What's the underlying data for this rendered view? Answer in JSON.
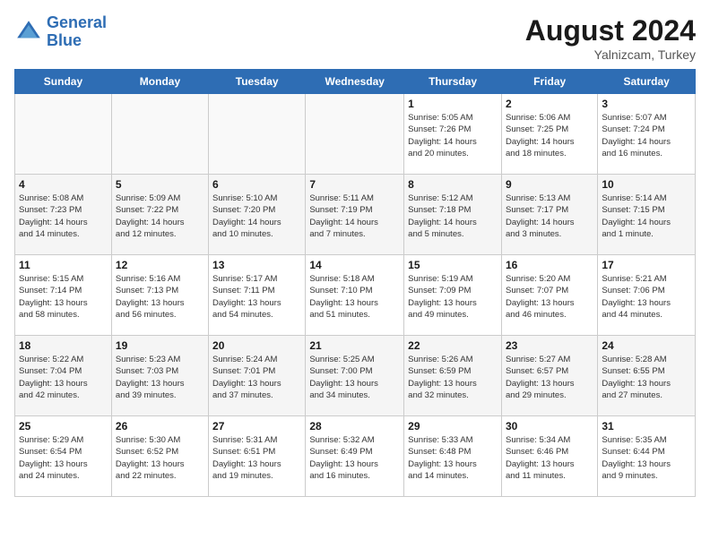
{
  "header": {
    "logo_line1": "General",
    "logo_line2": "Blue",
    "month_year": "August 2024",
    "location": "Yalnizcam, Turkey"
  },
  "weekdays": [
    "Sunday",
    "Monday",
    "Tuesday",
    "Wednesday",
    "Thursday",
    "Friday",
    "Saturday"
  ],
  "weeks": [
    [
      {
        "day": "",
        "info": ""
      },
      {
        "day": "",
        "info": ""
      },
      {
        "day": "",
        "info": ""
      },
      {
        "day": "",
        "info": ""
      },
      {
        "day": "1",
        "info": "Sunrise: 5:05 AM\nSunset: 7:26 PM\nDaylight: 14 hours\nand 20 minutes."
      },
      {
        "day": "2",
        "info": "Sunrise: 5:06 AM\nSunset: 7:25 PM\nDaylight: 14 hours\nand 18 minutes."
      },
      {
        "day": "3",
        "info": "Sunrise: 5:07 AM\nSunset: 7:24 PM\nDaylight: 14 hours\nand 16 minutes."
      }
    ],
    [
      {
        "day": "4",
        "info": "Sunrise: 5:08 AM\nSunset: 7:23 PM\nDaylight: 14 hours\nand 14 minutes."
      },
      {
        "day": "5",
        "info": "Sunrise: 5:09 AM\nSunset: 7:22 PM\nDaylight: 14 hours\nand 12 minutes."
      },
      {
        "day": "6",
        "info": "Sunrise: 5:10 AM\nSunset: 7:20 PM\nDaylight: 14 hours\nand 10 minutes."
      },
      {
        "day": "7",
        "info": "Sunrise: 5:11 AM\nSunset: 7:19 PM\nDaylight: 14 hours\nand 7 minutes."
      },
      {
        "day": "8",
        "info": "Sunrise: 5:12 AM\nSunset: 7:18 PM\nDaylight: 14 hours\nand 5 minutes."
      },
      {
        "day": "9",
        "info": "Sunrise: 5:13 AM\nSunset: 7:17 PM\nDaylight: 14 hours\nand 3 minutes."
      },
      {
        "day": "10",
        "info": "Sunrise: 5:14 AM\nSunset: 7:15 PM\nDaylight: 14 hours\nand 1 minute."
      }
    ],
    [
      {
        "day": "11",
        "info": "Sunrise: 5:15 AM\nSunset: 7:14 PM\nDaylight: 13 hours\nand 58 minutes."
      },
      {
        "day": "12",
        "info": "Sunrise: 5:16 AM\nSunset: 7:13 PM\nDaylight: 13 hours\nand 56 minutes."
      },
      {
        "day": "13",
        "info": "Sunrise: 5:17 AM\nSunset: 7:11 PM\nDaylight: 13 hours\nand 54 minutes."
      },
      {
        "day": "14",
        "info": "Sunrise: 5:18 AM\nSunset: 7:10 PM\nDaylight: 13 hours\nand 51 minutes."
      },
      {
        "day": "15",
        "info": "Sunrise: 5:19 AM\nSunset: 7:09 PM\nDaylight: 13 hours\nand 49 minutes."
      },
      {
        "day": "16",
        "info": "Sunrise: 5:20 AM\nSunset: 7:07 PM\nDaylight: 13 hours\nand 46 minutes."
      },
      {
        "day": "17",
        "info": "Sunrise: 5:21 AM\nSunset: 7:06 PM\nDaylight: 13 hours\nand 44 minutes."
      }
    ],
    [
      {
        "day": "18",
        "info": "Sunrise: 5:22 AM\nSunset: 7:04 PM\nDaylight: 13 hours\nand 42 minutes."
      },
      {
        "day": "19",
        "info": "Sunrise: 5:23 AM\nSunset: 7:03 PM\nDaylight: 13 hours\nand 39 minutes."
      },
      {
        "day": "20",
        "info": "Sunrise: 5:24 AM\nSunset: 7:01 PM\nDaylight: 13 hours\nand 37 minutes."
      },
      {
        "day": "21",
        "info": "Sunrise: 5:25 AM\nSunset: 7:00 PM\nDaylight: 13 hours\nand 34 minutes."
      },
      {
        "day": "22",
        "info": "Sunrise: 5:26 AM\nSunset: 6:59 PM\nDaylight: 13 hours\nand 32 minutes."
      },
      {
        "day": "23",
        "info": "Sunrise: 5:27 AM\nSunset: 6:57 PM\nDaylight: 13 hours\nand 29 minutes."
      },
      {
        "day": "24",
        "info": "Sunrise: 5:28 AM\nSunset: 6:55 PM\nDaylight: 13 hours\nand 27 minutes."
      }
    ],
    [
      {
        "day": "25",
        "info": "Sunrise: 5:29 AM\nSunset: 6:54 PM\nDaylight: 13 hours\nand 24 minutes."
      },
      {
        "day": "26",
        "info": "Sunrise: 5:30 AM\nSunset: 6:52 PM\nDaylight: 13 hours\nand 22 minutes."
      },
      {
        "day": "27",
        "info": "Sunrise: 5:31 AM\nSunset: 6:51 PM\nDaylight: 13 hours\nand 19 minutes."
      },
      {
        "day": "28",
        "info": "Sunrise: 5:32 AM\nSunset: 6:49 PM\nDaylight: 13 hours\nand 16 minutes."
      },
      {
        "day": "29",
        "info": "Sunrise: 5:33 AM\nSunset: 6:48 PM\nDaylight: 13 hours\nand 14 minutes."
      },
      {
        "day": "30",
        "info": "Sunrise: 5:34 AM\nSunset: 6:46 PM\nDaylight: 13 hours\nand 11 minutes."
      },
      {
        "day": "31",
        "info": "Sunrise: 5:35 AM\nSunset: 6:44 PM\nDaylight: 13 hours\nand 9 minutes."
      }
    ]
  ]
}
